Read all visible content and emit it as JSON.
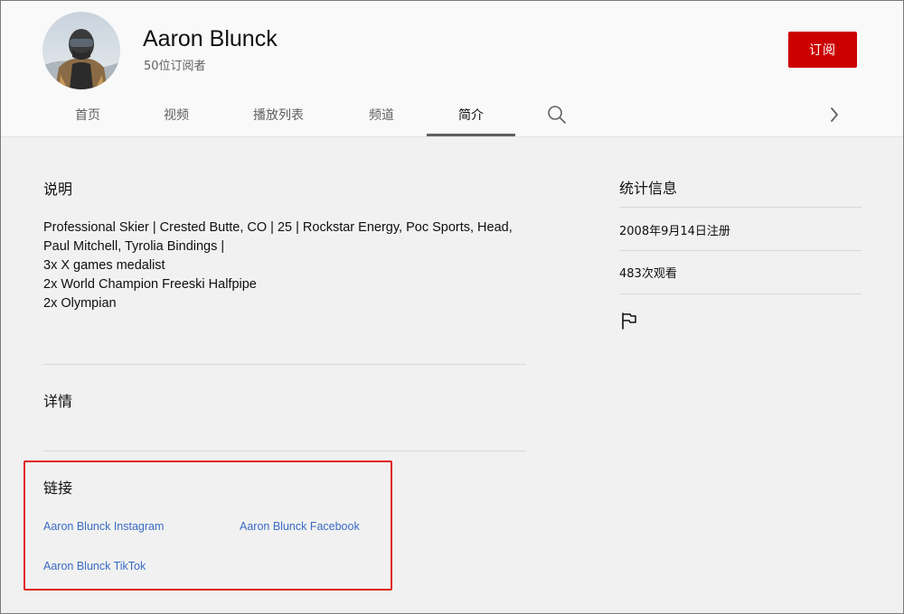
{
  "channel": {
    "name": "Aaron Blunck",
    "subscribers": "50位订阅者",
    "subscribe_label": "订阅"
  },
  "tabs": [
    {
      "label": "首页"
    },
    {
      "label": "视频"
    },
    {
      "label": "播放列表"
    },
    {
      "label": "频道"
    },
    {
      "label": "简介",
      "active": true
    }
  ],
  "icons": {
    "search": "search-icon",
    "next": "chevron-right-icon",
    "flag": "flag-icon"
  },
  "about": {
    "description_heading": "说明",
    "description_lines": [
      "Professional Skier | Crested Butte, CO | 25 | Rockstar Energy, Poc Sports, Head,",
      "Paul Mitchell, Tyrolia Bindings |",
      "3x X games medalist",
      "2x World Champion Freeski Halfpipe",
      "2x Olympian"
    ],
    "details_heading": "详情",
    "links_heading": "链接",
    "links": [
      "Aaron Blunck Instagram",
      "Aaron Blunck Facebook",
      "Aaron Blunck TikTok"
    ]
  },
  "stats": {
    "heading": "统计信息",
    "joined": "2008年9月14日注册",
    "views": "483次观看"
  },
  "colors": {
    "subscribe": "#cc0000",
    "link": "#3a6bc4",
    "highlight": "#e11d1d"
  }
}
